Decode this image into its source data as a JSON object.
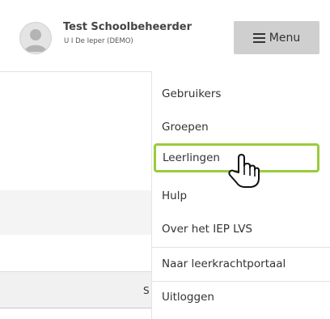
{
  "header": {
    "user_name": "Test Schoolbeheerder",
    "user_subtitle": "U I De Ieper (DEMO)",
    "menu_label": "Menu",
    "menu_icon": "hamburger-icon",
    "avatar_icon": "user-avatar-icon"
  },
  "dropdown": {
    "items": [
      {
        "label": "Gebruikers"
      },
      {
        "label": "Groepen"
      },
      {
        "label": "Leerlingen",
        "highlighted": true
      },
      {
        "label": "Hulp"
      },
      {
        "label": "Over het IEP LVS"
      },
      {
        "label": "Naar leerkrachtportaal"
      },
      {
        "label": "Uitloggen"
      }
    ],
    "highlight_color": "#9acb3c"
  },
  "background": {
    "partial_text": "S"
  },
  "cursor": {
    "icon": "hand-pointer-icon"
  }
}
